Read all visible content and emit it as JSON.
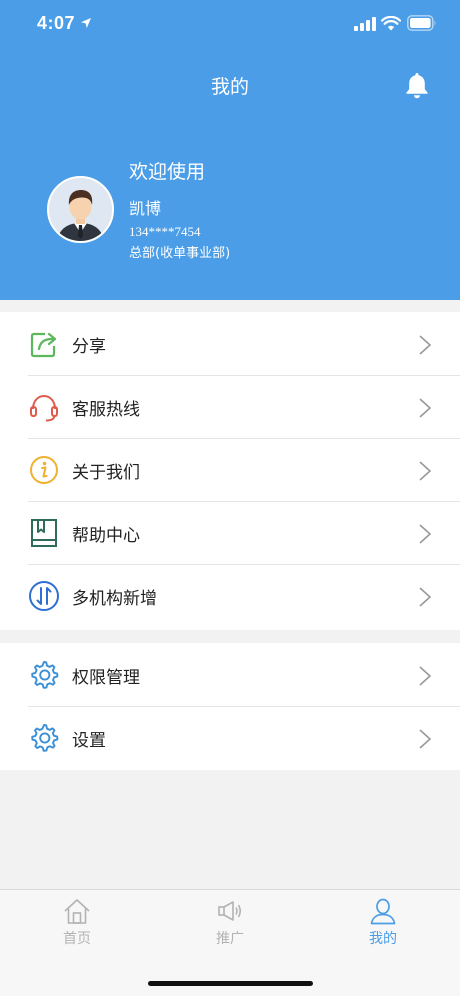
{
  "status_bar": {
    "time": "4:07",
    "icons": [
      "location-arrow-icon",
      "signal-icon",
      "wifi-icon",
      "battery-icon"
    ]
  },
  "header": {
    "title": "我的",
    "bell_icon": "bell-icon",
    "background_color": "#4a9de6"
  },
  "profile": {
    "welcome": "欢迎使用",
    "name": "凯博",
    "phone": "134****7454",
    "department": "总部(收单事业部)"
  },
  "menu_group_1": [
    {
      "label": "分享",
      "icon": "share-icon",
      "color": "#5cb85c"
    },
    {
      "label": "客服热线",
      "icon": "headset-icon",
      "color": "#e05a4a"
    },
    {
      "label": "关于我们",
      "icon": "info-icon",
      "color": "#f0b030"
    },
    {
      "label": "帮助中心",
      "icon": "book-icon",
      "color": "#2f6b5a"
    },
    {
      "label": "多机构新增",
      "icon": "transfer-icon",
      "color": "#2f6fd1"
    }
  ],
  "menu_group_2": [
    {
      "label": "权限管理",
      "icon": "gear-icon",
      "color": "#3a8fd6"
    },
    {
      "label": "设置",
      "icon": "gear-icon",
      "color": "#3a8fd6"
    }
  ],
  "tab_bar": {
    "tabs": [
      {
        "label": "首页",
        "icon": "home-icon"
      },
      {
        "label": "推广",
        "icon": "megaphone-icon"
      },
      {
        "label": "我的",
        "icon": "user-icon"
      }
    ],
    "active": "我的",
    "active_color": "#4a9de6",
    "inactive_color": "#b3b3b3"
  }
}
